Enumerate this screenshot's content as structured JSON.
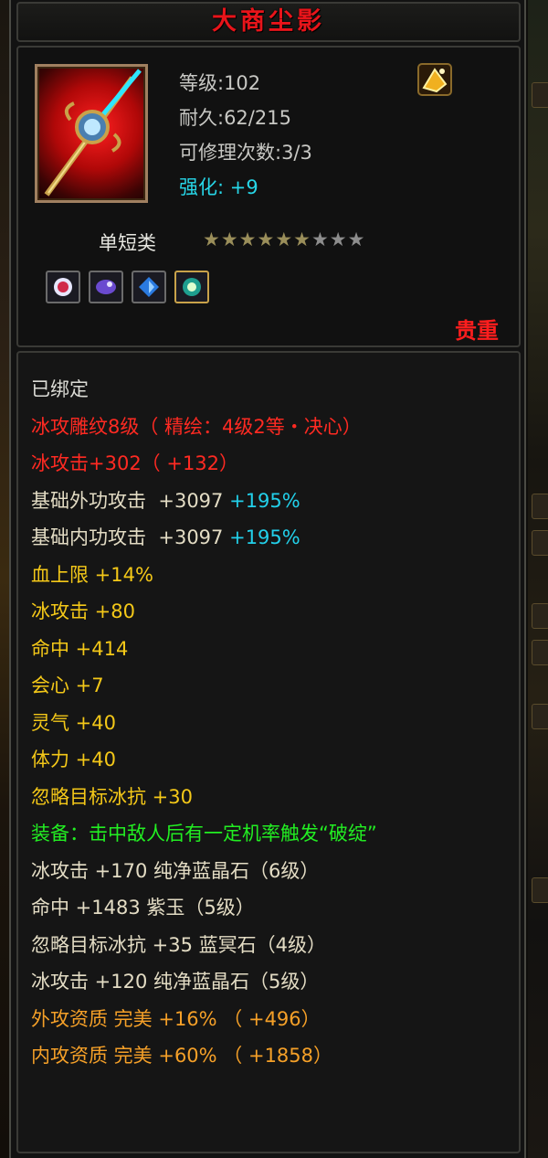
{
  "item": {
    "name": "大商尘影",
    "level": "等级:102",
    "durability": "耐久:62/215",
    "repairs": "可修理次数:3/3",
    "enhance_label": "强化:",
    "enhance_value": "+9",
    "category": "单短类",
    "stars_total": 9,
    "stars_filled": 6,
    "rarity": "贵重",
    "sockets": [
      "red-gem-icon",
      "purple-gem-icon",
      "blue-gem-icon",
      "green-gem-icon"
    ]
  },
  "attributes": {
    "bound": "已绑定",
    "engrave": "冰攻雕纹8级（ 精绘：4级2等・决心）",
    "ice_attack": "冰攻击+302（ +132）",
    "ext_attack": {
      "label": "基础外功攻击",
      "value": "+3097",
      "bonus": "+195%"
    },
    "int_attack": {
      "label": "基础内功攻击",
      "value": "+3097",
      "bonus": "+195%"
    },
    "stats": [
      "血上限  +14%",
      "冰攻击  +80",
      "命中  +414",
      "会心  +7",
      "灵气  +40",
      "体力  +40",
      "忽略目标冰抗  +30"
    ],
    "equip_effect": "装备：击中敌人后有一定机率触发“破绽”",
    "gems": [
      "冰攻击  +170  纯净蓝晶石（6级）",
      "命中  +1483  紫玉（5级）",
      "忽略目标冰抗  +35  蓝冥石（4级）",
      "冰攻击  +120  纯净蓝晶石（5级）"
    ],
    "qualities": [
      "外攻资质   完美  +16%  （ +496）",
      "内攻资质   完美  +60%  （ +1858）"
    ]
  },
  "colors": {
    "title": "#e8141a",
    "enhance": "#27d7e8",
    "red_text": "#ff2a22",
    "cyan_bonus": "#22d0ea",
    "yellow_stat": "#f4c818",
    "green_effect": "#22ee22",
    "orange_quality": "#f5a028"
  }
}
